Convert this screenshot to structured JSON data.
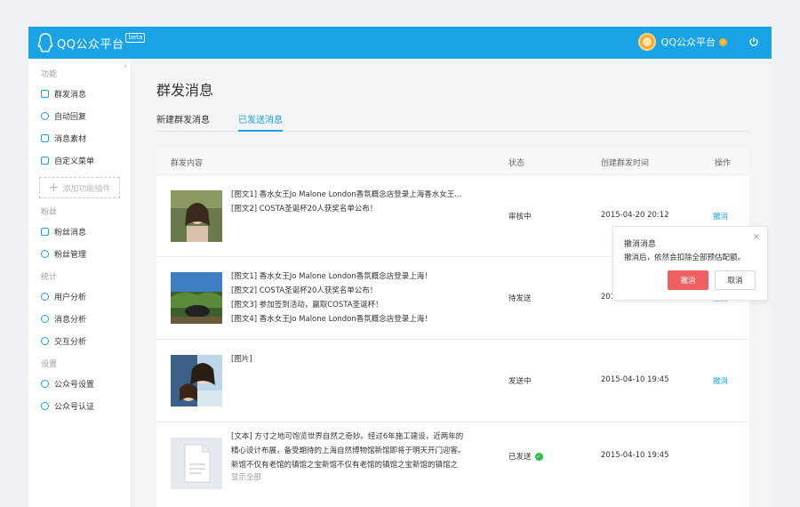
{
  "header": {
    "app_title": "QQ公众平台",
    "beta": "beta",
    "account_name": "QQ公众平台"
  },
  "sidebar": {
    "sections": [
      {
        "title": "功能",
        "items": [
          "群发消息",
          "自动回复",
          "消息素材",
          "自定义菜单"
        ]
      },
      {
        "title": "粉丝",
        "items": [
          "粉丝消息",
          "粉丝管理"
        ]
      },
      {
        "title": "统计",
        "items": [
          "用户分析",
          "消息分析",
          "交互分析"
        ]
      },
      {
        "title": "设置",
        "items": [
          "公众号设置",
          "公众号认证"
        ]
      }
    ],
    "add_plugin": "添加功能插件"
  },
  "page": {
    "title": "群发消息",
    "tabs": [
      "新建群发消息",
      "已发送消息"
    ],
    "active_tab": 1
  },
  "table": {
    "columns": [
      "群发内容",
      "状态",
      "创建群发时间",
      "操作"
    ],
    "rows": [
      {
        "lines": [
          "[图文1] 香水女王Jo Malone London香氛概念店登录上海香水女王...",
          "[图文2] COSTA圣诞杯20人获奖名单公布！"
        ],
        "status": "审核中",
        "time": "2015-04-20  20:12",
        "op": "撤消"
      },
      {
        "lines": [
          "[图文1] 香水女王Jo Malone London香氛概念店登录上海！",
          "[图文2] COSTA圣诞杯20人获奖名单公布！",
          "[图文3] 参加签到活动，赢取COSTA圣诞杯！",
          "[图文4] 香水女王Jo Malone London香氛概念店登录上海！"
        ],
        "status": "待发送",
        "time": "2015-04-20  20:12",
        "op": "撤消"
      },
      {
        "lines": [
          "[图片]"
        ],
        "status": "发送中",
        "time": "2015-04-10  19:45",
        "op": "撤消"
      },
      {
        "lines": [
          "[文本] 方寸之地可饱览世界自然之奇妙。经过6年施工建设，近两年的",
          "精心设计布展，备受期待的上海自然博物馆新馆即将于明天开门迎客。",
          "新馆不仅有老馆的镇馆之宝新馆不仅有老馆的镇馆之宝新馆的镇馆之"
        ],
        "show_all": "显示全部",
        "status": "已发送",
        "time": "2015-04-10  19:45",
        "op": ""
      }
    ]
  },
  "popover": {
    "title": "撤消消息",
    "message": "撤消后，依然会扣除全部预估配额。",
    "confirm": "撤消",
    "cancel": "取消",
    "close": "×"
  },
  "colors": {
    "brand": "#1aa3e6",
    "danger": "#f06060",
    "success": "#27c04a"
  }
}
